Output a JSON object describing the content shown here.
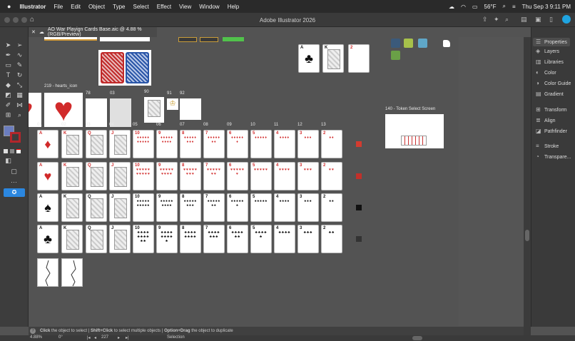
{
  "menubar": {
    "app": "Illustrator",
    "items": [
      "File",
      "Edit",
      "Object",
      "Type",
      "Select",
      "Effect",
      "View",
      "Window",
      "Help"
    ],
    "weather": "56°F",
    "clock": "Thu Sep 3  9:11 PM"
  },
  "window": {
    "title": "Adobe Illustrator 2026"
  },
  "doc_tab": {
    "label": "AO War Playign Cards Base.aic @ 4.88 % (RGB/Preview)"
  },
  "artboard_labels": {
    "hearts_icon": "219 - hearts_icon",
    "n78": "78",
    "n03": "03",
    "n90": "90",
    "n91": "91",
    "n92": "92",
    "token": "140 - Token Select Screen",
    "cols": [
      "01",
      "02",
      "03",
      "04",
      "05",
      "06",
      "07",
      "08",
      "09",
      "10",
      "11",
      "12",
      "13"
    ]
  },
  "rows": [
    {
      "suit": "♦",
      "color": "red",
      "labels": [
        "A",
        "K",
        "Q",
        "J",
        "10",
        "9",
        "8",
        "7",
        "6",
        "5",
        "4",
        "3",
        "2"
      ]
    },
    {
      "suit": "♥",
      "color": "red",
      "labels": [
        "A",
        "K",
        "Q",
        "J",
        "10",
        "9",
        "8",
        "7",
        "6",
        "5",
        "4",
        "3",
        "2"
      ]
    },
    {
      "suit": "♠",
      "color": "blk",
      "labels": [
        "A",
        "K",
        "Q",
        "J",
        "10",
        "9",
        "8",
        "7",
        "6",
        "5",
        "4",
        "3",
        "2"
      ]
    },
    {
      "suit": "♣",
      "color": "blk",
      "labels": [
        "A",
        "K",
        "Q",
        "J",
        "10",
        "9",
        "8",
        "7",
        "6",
        "5",
        "4",
        "3",
        "2"
      ]
    }
  ],
  "swatches": [
    "#d33b2f",
    "#c2302a",
    "#111111",
    "#333333"
  ],
  "top_cards": [
    {
      "label": "A",
      "suit": "♣",
      "color": "blk"
    },
    {
      "label": "K",
      "suit": "",
      "color": "blk"
    },
    {
      "label": "2",
      "suit": "",
      "color": "red"
    }
  ],
  "panel": {
    "items": [
      {
        "label": "Properties",
        "icon": "properties-icon"
      },
      {
        "label": "Layers",
        "icon": "layers-icon"
      },
      {
        "label": "Libraries",
        "icon": "libraries-icon"
      },
      {
        "label": "Color",
        "icon": "color-icon"
      },
      {
        "label": "Color Guide",
        "icon": "color-guide-icon"
      },
      {
        "label": "Gradient",
        "icon": "gradient-icon"
      },
      {
        "label": "Transform",
        "icon": "transform-icon"
      },
      {
        "label": "Align",
        "icon": "align-icon"
      },
      {
        "label": "Pathfinder",
        "icon": "pathfinder-icon"
      },
      {
        "label": "Stroke",
        "icon": "stroke-icon"
      },
      {
        "label": "Transpare...",
        "icon": "transparency-icon"
      }
    ]
  },
  "status": {
    "b1": "Click",
    "t1": "the object to select",
    "b2": "Shift+Click",
    "t2": "to select multiple objects",
    "b3": "Option+Drag",
    "t3": "the object to duplicate"
  },
  "footer": {
    "zoom": "4.88%",
    "rotate": "0°",
    "artboard": "227",
    "mode": "Selection"
  }
}
